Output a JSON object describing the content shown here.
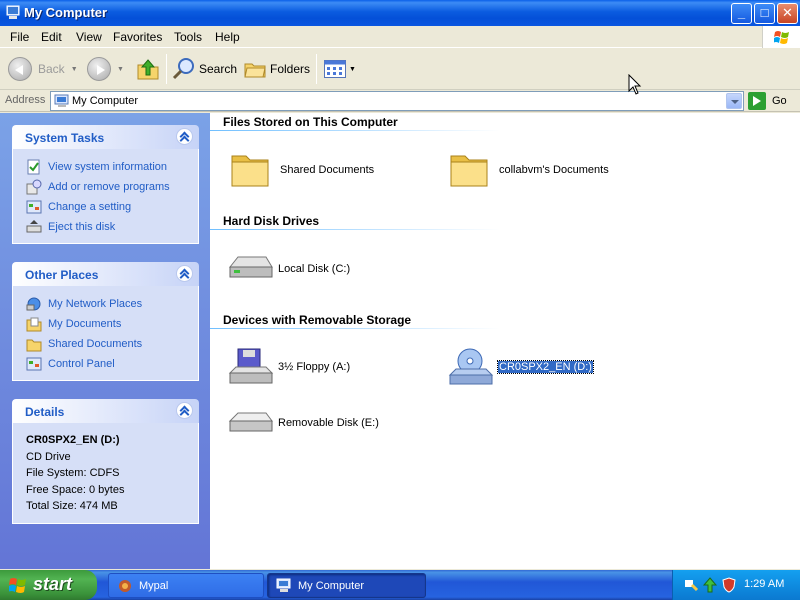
{
  "window": {
    "title": "My Computer",
    "controls": {
      "minimize": "_",
      "maximize": "□",
      "close": "✕"
    }
  },
  "menubar": {
    "items": [
      "File",
      "Edit",
      "View",
      "Favorites",
      "Tools",
      "Help"
    ]
  },
  "toolbar": {
    "back_label": "Back",
    "search_label": "Search",
    "folders_label": "Folders"
  },
  "address": {
    "label": "Address",
    "value": "My Computer",
    "go_label": "Go"
  },
  "left_pane": {
    "system_tasks": {
      "title": "System Tasks",
      "items": [
        {
          "label": "View system information",
          "icon": "system-info-icon"
        },
        {
          "label": "Add or remove programs",
          "icon": "add-remove-programs-icon"
        },
        {
          "label": "Change a setting",
          "icon": "control-panel-icon"
        },
        {
          "label": "Eject this disk",
          "icon": "eject-disk-icon"
        }
      ]
    },
    "other_places": {
      "title": "Other Places",
      "items": [
        {
          "label": "My Network Places",
          "icon": "network-places-icon"
        },
        {
          "label": "My Documents",
          "icon": "my-documents-icon"
        },
        {
          "label": "Shared Documents",
          "icon": "shared-documents-icon"
        },
        {
          "label": "Control Panel",
          "icon": "control-panel-icon"
        }
      ]
    },
    "details": {
      "title": "Details",
      "name": "CR0SPX2_EN (D:)",
      "type": "CD Drive",
      "file_system": "File System: CDFS",
      "free_space": "Free Space: 0 bytes",
      "total_size": "Total Size: 474 MB"
    }
  },
  "content": {
    "groups": [
      {
        "title": "Files Stored on This Computer",
        "items": [
          {
            "label": "Shared Documents",
            "icon": "folder-icon"
          },
          {
            "label": "collabvm's Documents",
            "icon": "folder-icon"
          }
        ]
      },
      {
        "title": "Hard Disk Drives",
        "items": [
          {
            "label": "Local Disk (C:)",
            "icon": "hard-disk-icon"
          }
        ]
      },
      {
        "title": "Devices with Removable Storage",
        "items": [
          {
            "label": "3½ Floppy (A:)",
            "icon": "floppy-drive-icon"
          },
          {
            "label": "CR0SPX2_EN (D:)",
            "icon": "cd-drive-icon",
            "selected": true
          },
          {
            "label": "Removable Disk (E:)",
            "icon": "removable-disk-icon"
          }
        ]
      }
    ]
  },
  "taskbar": {
    "start_label": "start",
    "buttons": [
      {
        "label": "Mypal",
        "icon": "mypal-icon",
        "active": false
      },
      {
        "label": "My Computer",
        "icon": "my-computer-icon",
        "active": true
      }
    ],
    "tray": {
      "clock": "1:29 AM"
    }
  },
  "colors": {
    "titlebar": "#0a56e0",
    "task_link": "#215dc6",
    "pane_gradient_top": "#7ba2e7",
    "selection": "#316ac5",
    "taskbar": "#2157d7",
    "start_green": "#3a923a"
  }
}
